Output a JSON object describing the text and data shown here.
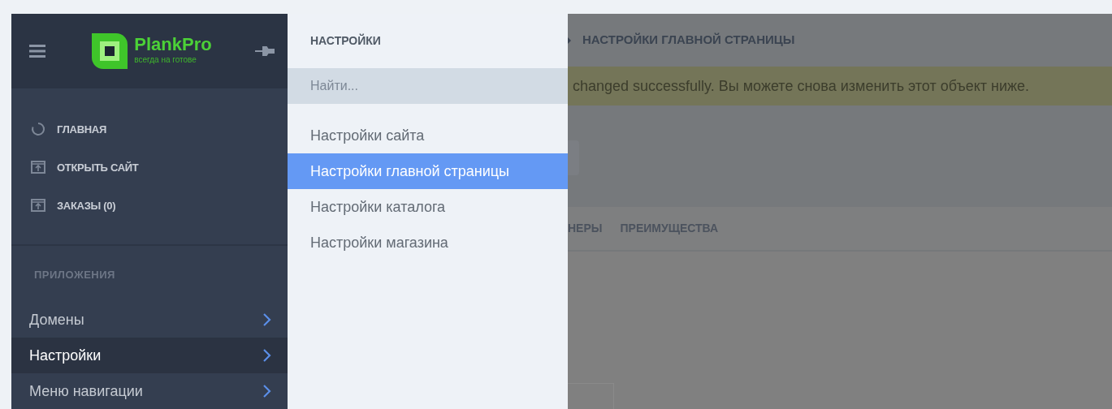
{
  "sidebar": {
    "logo": {
      "name": "PlankPro",
      "tagline": "всегда на готове"
    },
    "main_items": [
      {
        "label": "ГЛАВНАЯ",
        "kind": "dashboard"
      },
      {
        "label": "ОТКРЫТЬ САЙТ",
        "kind": "external"
      },
      {
        "label": "ЗАКАЗЫ (0)",
        "kind": "external"
      }
    ],
    "section_title": "ПРИЛОЖЕНИЯ",
    "apps": [
      {
        "label": "Домены",
        "selected": false
      },
      {
        "label": "Настройки",
        "selected": true
      },
      {
        "label": "Меню навигации",
        "selected": false
      }
    ]
  },
  "flyout": {
    "title": "НАСТРОЙКИ",
    "search": {
      "placeholder": "Найти..."
    },
    "items": [
      {
        "label": "Настройки сайта",
        "selected": false
      },
      {
        "label": "Настройки главной страницы",
        "selected": true
      },
      {
        "label": "Настройки каталога",
        "selected": false
      },
      {
        "label": "Настройки магазина",
        "selected": false
      }
    ]
  },
  "main": {
    "breadcrumb": "НАСТРОЙКИ ГЛАВНОЙ СТРАНИЦЫ",
    "alert": "changed successfully. Вы можете снова изменить этот объект ниже.",
    "tabs": [
      {
        "label": "НЕРЫ"
      },
      {
        "label": "ПРЕИМУЩЕСТВА"
      }
    ]
  }
}
